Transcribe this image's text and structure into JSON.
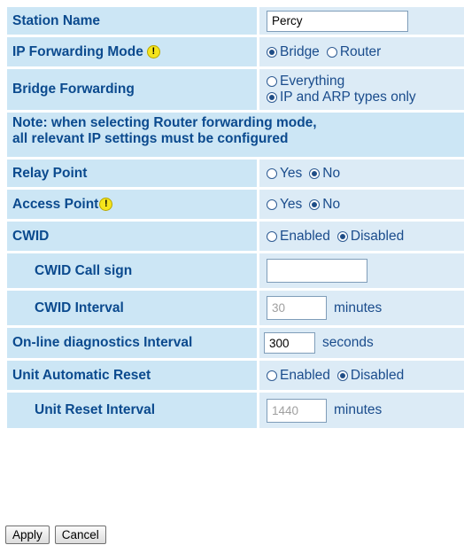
{
  "station_name": {
    "label": "Station Name",
    "value": "Percy"
  },
  "ip_forwarding_mode": {
    "label": "IP Forwarding Mode",
    "warn_icon": "exclamation-icon",
    "options": [
      "Bridge",
      "Router"
    ],
    "selected": "Bridge"
  },
  "bridge_forwarding": {
    "label": "Bridge Forwarding",
    "options": [
      "Everything",
      "IP and ARP types only"
    ],
    "selected": "IP and ARP types only"
  },
  "note": {
    "line1": "Note: when selecting Router forwarding mode,",
    "line2": "all relevant IP settings must be configured"
  },
  "relay_point": {
    "label": "Relay Point",
    "options": [
      "Yes",
      "No"
    ],
    "selected": "No"
  },
  "access_point": {
    "label": "Access Point",
    "warn_icon": "exclamation-icon",
    "options": [
      "Yes",
      "No"
    ],
    "selected": "No"
  },
  "cwid": {
    "label": "CWID",
    "options": [
      "Enabled",
      "Disabled"
    ],
    "selected": "Disabled"
  },
  "cwid_call_sign": {
    "label": "CWID Call sign",
    "value": ""
  },
  "cwid_interval": {
    "label": "CWID Interval",
    "value": "30",
    "unit": "minutes"
  },
  "online_diag": {
    "label": "On-line diagnostics Interval",
    "value": "300",
    "unit": "seconds"
  },
  "unit_auto_reset": {
    "label": "Unit Automatic Reset",
    "options": [
      "Enabled",
      "Disabled"
    ],
    "selected": "Disabled"
  },
  "unit_reset_interval": {
    "label": "Unit Reset Interval",
    "value": "1440",
    "unit": "minutes"
  },
  "buttons": {
    "apply": "Apply",
    "cancel": "Cancel"
  },
  "colors": {
    "label_bg": "#cce6f5",
    "value_bg": "#dcebf6",
    "label_text": "#0b4a8e"
  }
}
